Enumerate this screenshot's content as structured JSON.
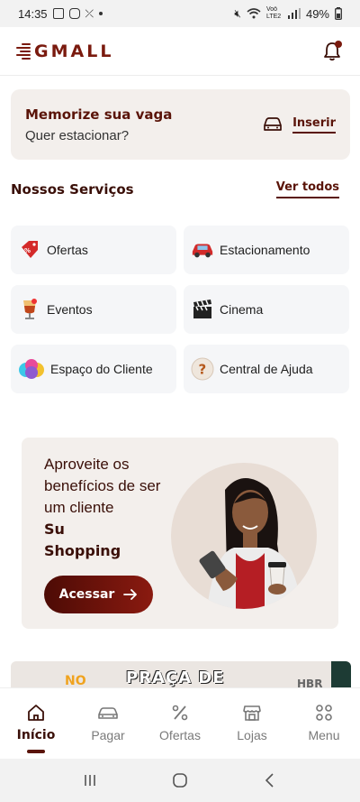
{
  "status_bar": {
    "time": "14:35",
    "signal_label": "Voö LTE2",
    "battery": "49%"
  },
  "header": {
    "logo_text": "GMALL"
  },
  "parking": {
    "title": "Memorize sua vaga",
    "subtitle": "Quer estacionar?",
    "action_label": "Inserir"
  },
  "services_section": {
    "title": "Nossos Serviços",
    "see_all": "Ver todos",
    "items": [
      {
        "label": "Ofertas",
        "icon": "offer-tag-icon"
      },
      {
        "label": "Estacionamento",
        "icon": "car-icon"
      },
      {
        "label": "Eventos",
        "icon": "drink-icon"
      },
      {
        "label": "Cinema",
        "icon": "clapperboard-icon"
      },
      {
        "label": "Espaço do Cliente",
        "icon": "gift-icon"
      },
      {
        "label": "Central de Ajuda",
        "icon": "question-icon"
      }
    ]
  },
  "promo": {
    "text_1": "Aproveite os",
    "text_2": "benefícios de ser",
    "text_3": "um cliente",
    "brand_1": "Su",
    "brand_2": "Shopping",
    "button_label": "Acessar"
  },
  "banner": {
    "text_orange": "NO",
    "text_promo": "PRAÇA DE",
    "text_hbr": "HBR"
  },
  "bottom_nav": {
    "items": [
      {
        "label": "Início",
        "icon": "home-icon",
        "active": true
      },
      {
        "label": "Pagar",
        "icon": "car-icon",
        "active": false
      },
      {
        "label": "Ofertas",
        "icon": "percent-icon",
        "active": false
      },
      {
        "label": "Lojas",
        "icon": "store-icon",
        "active": false
      },
      {
        "label": "Menu",
        "icon": "grid-icon",
        "active": false
      }
    ]
  },
  "colors": {
    "brand": "#7a1a0e",
    "brand_dark": "#3a0f08",
    "card_bg": "#f3efec",
    "service_bg": "#f5f6f8"
  }
}
